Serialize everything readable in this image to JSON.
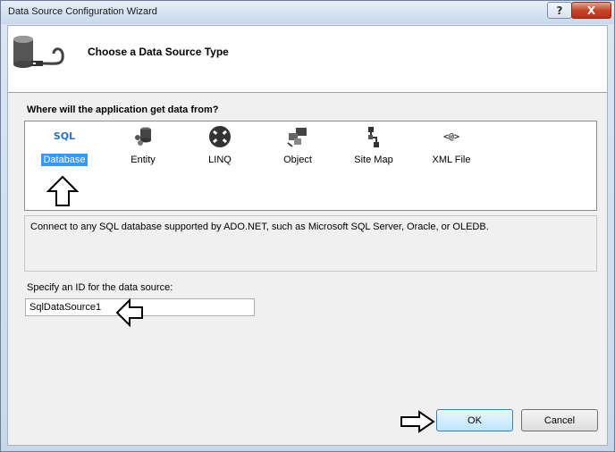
{
  "window": {
    "title": "Data Source Configuration Wizard",
    "help_label": "?",
    "close_label": "X"
  },
  "header": {
    "title": "Choose a Data Source Type"
  },
  "question": "Where will the application get data from?",
  "types": [
    {
      "label": "Database",
      "icon": "sql-database-icon",
      "selected": true
    },
    {
      "label": "Entity",
      "icon": "entity-icon",
      "selected": false
    },
    {
      "label": "LINQ",
      "icon": "linq-icon",
      "selected": false
    },
    {
      "label": "Object",
      "icon": "object-icon",
      "selected": false
    },
    {
      "label": "Site Map",
      "icon": "site-map-icon",
      "selected": false
    },
    {
      "label": "XML File",
      "icon": "xml-file-icon",
      "selected": false
    }
  ],
  "sql_icon_text": "SQL",
  "xml_icon_text": "<@>",
  "description": "Connect to any SQL database supported by ADO.NET, such as Microsoft SQL Server, Oracle, or OLEDB.",
  "id_field": {
    "label": "Specify an ID for the data source:",
    "value": "SqlDataSource1"
  },
  "buttons": {
    "ok": "OK",
    "cancel": "Cancel"
  }
}
